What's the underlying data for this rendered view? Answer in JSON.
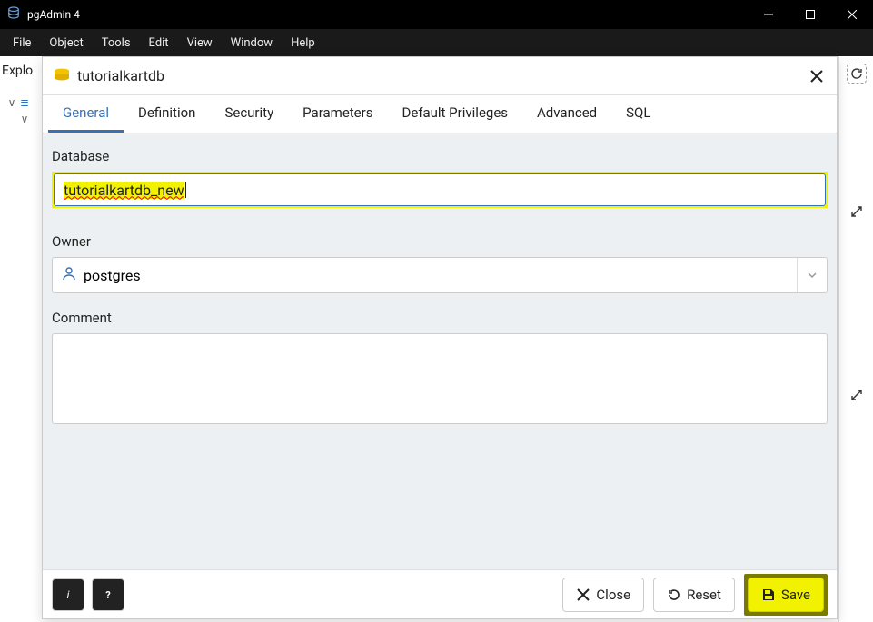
{
  "window": {
    "title": "pgAdmin 4"
  },
  "menubar": {
    "items": [
      "File",
      "Object",
      "Tools",
      "Edit",
      "View",
      "Window",
      "Help"
    ]
  },
  "explorer": {
    "label": "Explo"
  },
  "dialog": {
    "title": "tutorialkartdb",
    "tabs": [
      "General",
      "Definition",
      "Security",
      "Parameters",
      "Default Privileges",
      "Advanced",
      "SQL"
    ],
    "active_tab": 0,
    "fields": {
      "database_label": "Database",
      "database_value": "tutorialkartdb_new",
      "owner_label": "Owner",
      "owner_value": "postgres",
      "comment_label": "Comment",
      "comment_value": ""
    },
    "footer": {
      "close": "Close",
      "reset": "Reset",
      "save": "Save"
    }
  }
}
